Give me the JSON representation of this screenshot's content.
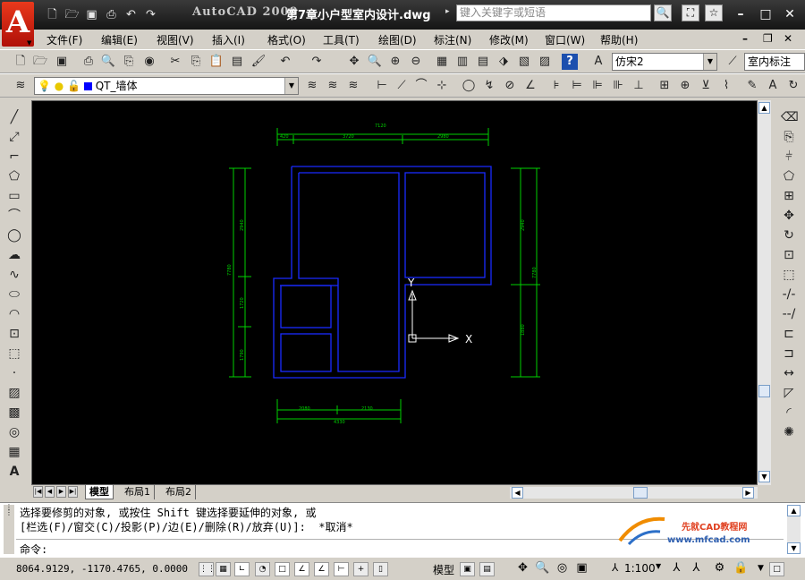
{
  "app": {
    "name": "AutoCAD 2009",
    "document": "第7章小户型室内设计.dwg",
    "logo_letter": "A",
    "search_placeholder": "键入关键字或短语"
  },
  "menu": [
    "文件(F)",
    "编辑(E)",
    "视图(V)",
    "插入(I)",
    "格式(O)",
    "工具(T)",
    "绘图(D)",
    "标注(N)",
    "修改(M)",
    "窗口(W)",
    "帮助(H)"
  ],
  "toolbar": {
    "text_style": "仿宋2",
    "dim_style": "室内标注",
    "layer": "QT_墙体"
  },
  "drawing": {
    "dims_top": {
      "total": "7120",
      "a": "420",
      "b": "3720",
      "c": "2980"
    },
    "dims_left": {
      "total": "7780",
      "a": "2940",
      "b": "1720",
      "c": "1790"
    },
    "dims_right": {
      "a": "2940",
      "b": "7780",
      "c": "1880"
    },
    "dims_bottom": {
      "total": "4330",
      "a": "2080",
      "b": "2130"
    },
    "ucs_x": "X",
    "ucs_y": "Y"
  },
  "layout_tabs": [
    "模型",
    "布局1",
    "布局2"
  ],
  "command": {
    "line1": "选择要修剪的对象, 或按住 Shift 键选择要延伸的对象, 或",
    "line2": "[栏选(F)/窗交(C)/投影(P)/边(E)/删除(R)/放弃(U)]:  *取消*",
    "prompt": "命令:"
  },
  "watermark": {
    "name": "先就CAD教程网",
    "url": "www.mfcad.com"
  },
  "status": {
    "coords": "8064.9129, -1170.4765, 0.0000",
    "model": "模型",
    "scale": "1:100"
  },
  "colors": {
    "title_bg": "#1e1e1e",
    "canvas_bg": "#000000",
    "wall": "#1a2bff",
    "dim": "#00ff00",
    "logo": "#e8391c"
  }
}
